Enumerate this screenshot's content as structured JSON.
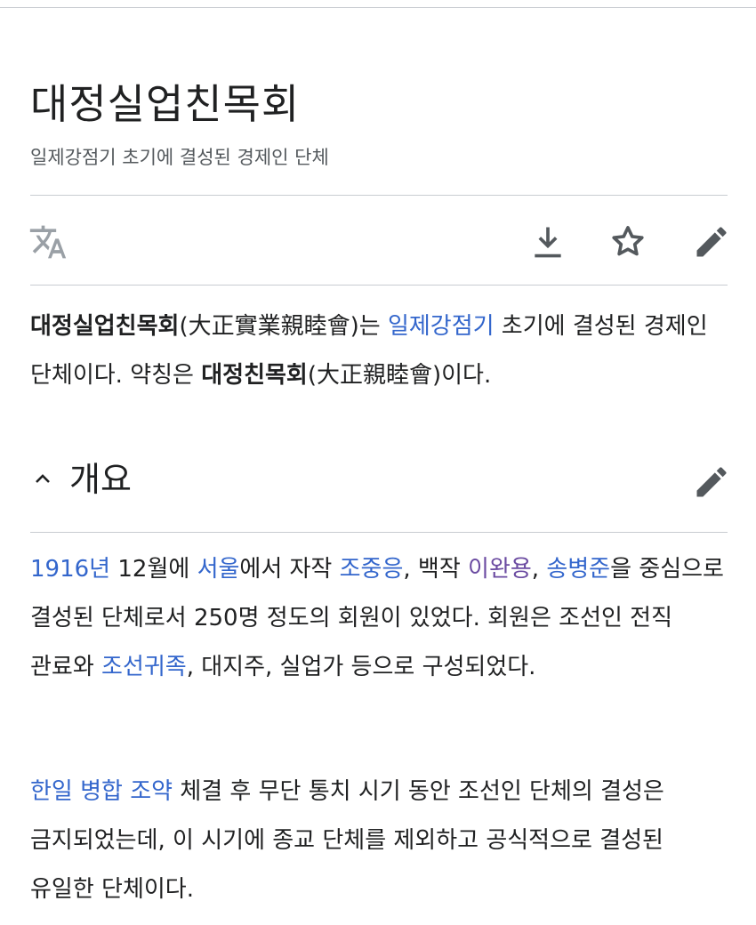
{
  "article": {
    "title": "대정실업친목회",
    "subtitle": "일제강점기 초기에 결성된 경제인 단체"
  },
  "toolbar": {
    "language_icon": "translate-icon",
    "download_icon": "download-icon",
    "watch_icon": "star-icon",
    "edit_icon": "pencil-icon"
  },
  "intro": {
    "s1_bold": "대정실업친목회",
    "s2": "(大正實業親睦會)는 ",
    "s3_link": "일제강점기",
    "s4": " 초기에 결성된 경제인 단체이다. 약칭은 ",
    "s5_bold": "대정친목회",
    "s6": "(大正親睦會)이다."
  },
  "section": {
    "title": "개요",
    "chevron_icon": "chevron-up-icon",
    "edit_icon": "pencil-icon"
  },
  "para1": {
    "l_1916": "1916년",
    "t1": " 12월에 ",
    "l_seoul": "서울",
    "t2": "에서 자작 ",
    "l_jo": "조중응",
    "t3": ", 백작 ",
    "l_lee": "이완용",
    "t4": ", ",
    "l_song": "송병준",
    "t5": "을 중심으로 결성된 단체로서 250명 정도의 회원이 있었다. 회원은 조선인 전직 관료와 ",
    "l_noble": "조선귀족",
    "t6": ", 대지주, 실업가 등으로 구성되었다."
  },
  "para2": {
    "l_treaty": "한일 병합 조약",
    "t1": " 체결 후 무단 통치 시기 동안 조선인 단체의 결성은 금지되었는데, 이 시기에 종교 단체를 제외하고 공식적으로 결성된 유일한 단체이다."
  },
  "colors": {
    "link": "#3366cc",
    "visited_link": "#6b4ba1",
    "text": "#202122",
    "muted": "#54595d",
    "divider": "#c8ccd1",
    "icon": "#54595d"
  }
}
